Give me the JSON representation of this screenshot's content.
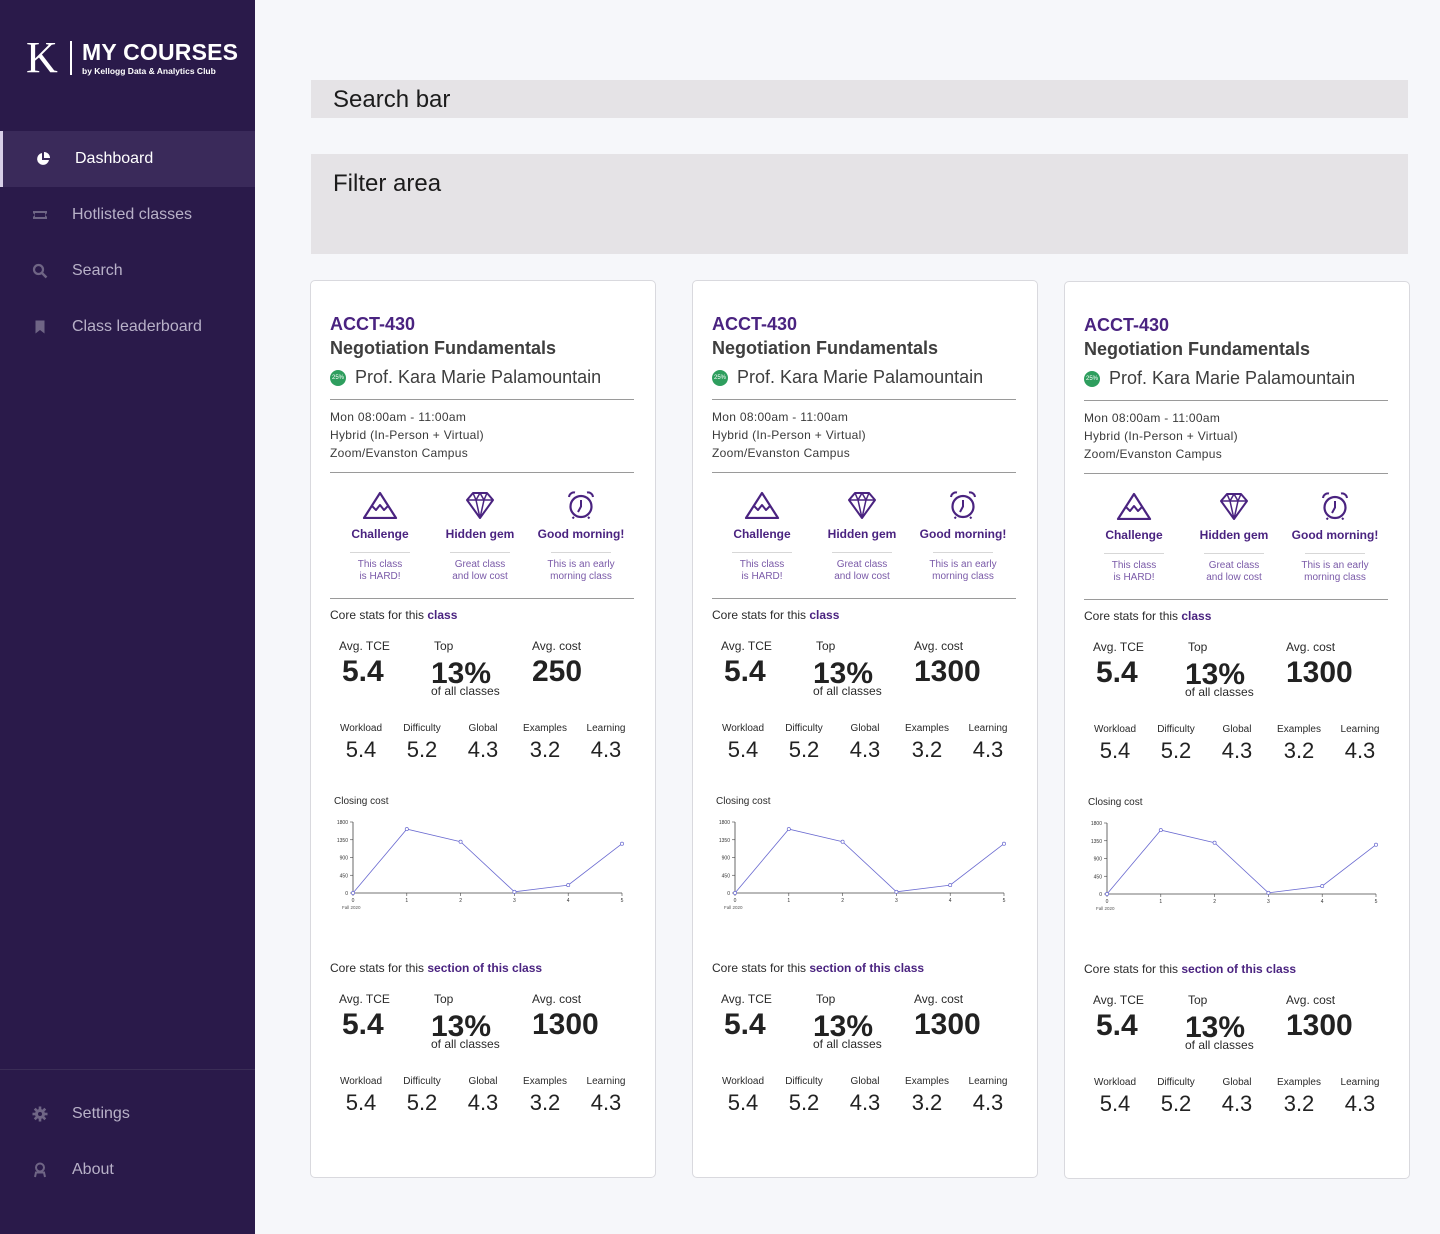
{
  "brand": {
    "letter": "K",
    "title": "MY COURSES",
    "subtitle": "by Kellogg Data & Analytics Club"
  },
  "nav": {
    "items": [
      {
        "label": "Dashboard",
        "icon": "pie-chart-icon",
        "active": true
      },
      {
        "label": "Hotlisted classes",
        "icon": "ticket-icon",
        "active": false
      },
      {
        "label": "Search",
        "icon": "search-icon",
        "active": false
      },
      {
        "label": "Class leaderboard",
        "icon": "bookmark-icon",
        "active": false
      }
    ],
    "bottom": [
      {
        "label": "Settings",
        "icon": "gear-icon"
      },
      {
        "label": "About",
        "icon": "person-icon"
      }
    ]
  },
  "search": {
    "label": "Search bar"
  },
  "filter": {
    "label": "Filter area"
  },
  "colors": {
    "sidebar": "#2a1a4a",
    "accent": "#4a2380",
    "badge": "#2e9e5e"
  },
  "cards": [
    {
      "code": "ACCT-430",
      "name": "Negotiation Fundamentals",
      "badge": "25%",
      "professor": "Prof. Kara Marie Palamountain",
      "schedule": "Mon 08:00am - 11:00am",
      "format": "Hybrid (In-Person + Virtual)",
      "location": "Zoom/Evanston Campus",
      "tags": [
        {
          "icon": "mountain-icon",
          "title": "Challenge",
          "desc1": "This class",
          "desc2": "is HARD!"
        },
        {
          "icon": "diamond-icon",
          "title": "Hidden gem",
          "desc1": "Great class",
          "desc2": "and low cost"
        },
        {
          "icon": "alarm-clock-icon",
          "title": "Good morning!",
          "desc1": "This is an early",
          "desc2": "morning class"
        }
      ],
      "class_stats": {
        "title_prefix": "Core stats for this",
        "title_emph": "class",
        "tce_label": "Avg. TCE",
        "tce": "5.4",
        "top_label": "Top",
        "top": "13%",
        "top_sub": "of all classes",
        "cost_label": "Avg. cost",
        "cost": "250",
        "small": [
          {
            "label": "Workload",
            "value": "5.4"
          },
          {
            "label": "Difficulty",
            "value": "5.2"
          },
          {
            "label": "Global",
            "value": "4.3"
          },
          {
            "label": "Examples",
            "value": "3.2"
          },
          {
            "label": "Learning",
            "value": "4.3"
          }
        ]
      },
      "chart_title": "Closing cost",
      "chart_xnote": "Fall 2020",
      "section_stats": {
        "title_prefix": "Core stats for this",
        "title_emph": "section of this class",
        "tce_label": "Avg. TCE",
        "tce": "5.4",
        "top_label": "Top",
        "top": "13%",
        "top_sub": "of all classes",
        "cost_label": "Avg. cost",
        "cost": "1300",
        "small": [
          {
            "label": "Workload",
            "value": "5.4"
          },
          {
            "label": "Difficulty",
            "value": "5.2"
          },
          {
            "label": "Global",
            "value": "4.3"
          },
          {
            "label": "Examples",
            "value": "3.2"
          },
          {
            "label": "Learning",
            "value": "4.3"
          }
        ]
      }
    },
    {
      "code": "ACCT-430",
      "name": "Negotiation Fundamentals",
      "badge": "25%",
      "professor": "Prof. Kara Marie Palamountain",
      "schedule": "Mon 08:00am - 11:00am",
      "format": "Hybrid (In-Person + Virtual)",
      "location": "Zoom/Evanston Campus",
      "tags": [
        {
          "icon": "mountain-icon",
          "title": "Challenge",
          "desc1": "This class",
          "desc2": "is HARD!"
        },
        {
          "icon": "diamond-icon",
          "title": "Hidden gem",
          "desc1": "Great class",
          "desc2": "and low cost"
        },
        {
          "icon": "alarm-clock-icon",
          "title": "Good morning!",
          "desc1": "This is an early",
          "desc2": "morning class"
        }
      ],
      "class_stats": {
        "title_prefix": "Core stats for this",
        "title_emph": "class",
        "tce_label": "Avg. TCE",
        "tce": "5.4",
        "top_label": "Top",
        "top": "13%",
        "top_sub": "of all classes",
        "cost_label": "Avg. cost",
        "cost": "1300",
        "small": [
          {
            "label": "Workload",
            "value": "5.4"
          },
          {
            "label": "Difficulty",
            "value": "5.2"
          },
          {
            "label": "Global",
            "value": "4.3"
          },
          {
            "label": "Examples",
            "value": "3.2"
          },
          {
            "label": "Learning",
            "value": "4.3"
          }
        ]
      },
      "chart_title": "Closing cost",
      "chart_xnote": "Fall 2020",
      "section_stats": {
        "title_prefix": "Core stats for this",
        "title_emph": "section of this class",
        "tce_label": "Avg. TCE",
        "tce": "5.4",
        "top_label": "Top",
        "top": "13%",
        "top_sub": "of all classes",
        "cost_label": "Avg. cost",
        "cost": "1300",
        "small": [
          {
            "label": "Workload",
            "value": "5.4"
          },
          {
            "label": "Difficulty",
            "value": "5.2"
          },
          {
            "label": "Global",
            "value": "4.3"
          },
          {
            "label": "Examples",
            "value": "3.2"
          },
          {
            "label": "Learning",
            "value": "4.3"
          }
        ]
      }
    },
    {
      "code": "ACCT-430",
      "name": "Negotiation Fundamentals",
      "badge": "25%",
      "professor": "Prof. Kara Marie Palamountain",
      "schedule": "Mon 08:00am - 11:00am",
      "format": "Hybrid (In-Person + Virtual)",
      "location": "Zoom/Evanston Campus",
      "tags": [
        {
          "icon": "mountain-icon",
          "title": "Challenge",
          "desc1": "This class",
          "desc2": "is HARD!"
        },
        {
          "icon": "diamond-icon",
          "title": "Hidden gem",
          "desc1": "Great class",
          "desc2": "and low cost"
        },
        {
          "icon": "alarm-clock-icon",
          "title": "Good morning!",
          "desc1": "This is an early",
          "desc2": "morning class"
        }
      ],
      "class_stats": {
        "title_prefix": "Core stats for this",
        "title_emph": "class",
        "tce_label": "Avg. TCE",
        "tce": "5.4",
        "top_label": "Top",
        "top": "13%",
        "top_sub": "of all classes",
        "cost_label": "Avg. cost",
        "cost": "1300",
        "small": [
          {
            "label": "Workload",
            "value": "5.4"
          },
          {
            "label": "Difficulty",
            "value": "5.2"
          },
          {
            "label": "Global",
            "value": "4.3"
          },
          {
            "label": "Examples",
            "value": "3.2"
          },
          {
            "label": "Learning",
            "value": "4.3"
          }
        ]
      },
      "chart_title": "Closing cost",
      "chart_xnote": "Fall 2020",
      "section_stats": {
        "title_prefix": "Core stats for this",
        "title_emph": "section of this class",
        "tce_label": "Avg. TCE",
        "tce": "5.4",
        "top_label": "Top",
        "top": "13%",
        "top_sub": "of all classes",
        "cost_label": "Avg. cost",
        "cost": "1300",
        "small": [
          {
            "label": "Workload",
            "value": "5.4"
          },
          {
            "label": "Difficulty",
            "value": "5.2"
          },
          {
            "label": "Global",
            "value": "4.3"
          },
          {
            "label": "Examples",
            "value": "3.2"
          },
          {
            "label": "Learning",
            "value": "4.3"
          }
        ]
      }
    }
  ],
  "chart_data": {
    "type": "line",
    "title": "Closing cost",
    "x": [
      0,
      1,
      2,
      3,
      4,
      5
    ],
    "xticks": [
      "0",
      "1",
      "2",
      "3",
      "4",
      "5"
    ],
    "yticks": [
      "0",
      "450",
      "900",
      "1350",
      "1800"
    ],
    "ylim": [
      0,
      1800
    ],
    "series": [
      {
        "values": [
          0,
          1620,
          1300,
          30,
          200,
          1250
        ]
      }
    ],
    "color": "#6a6ad0"
  }
}
